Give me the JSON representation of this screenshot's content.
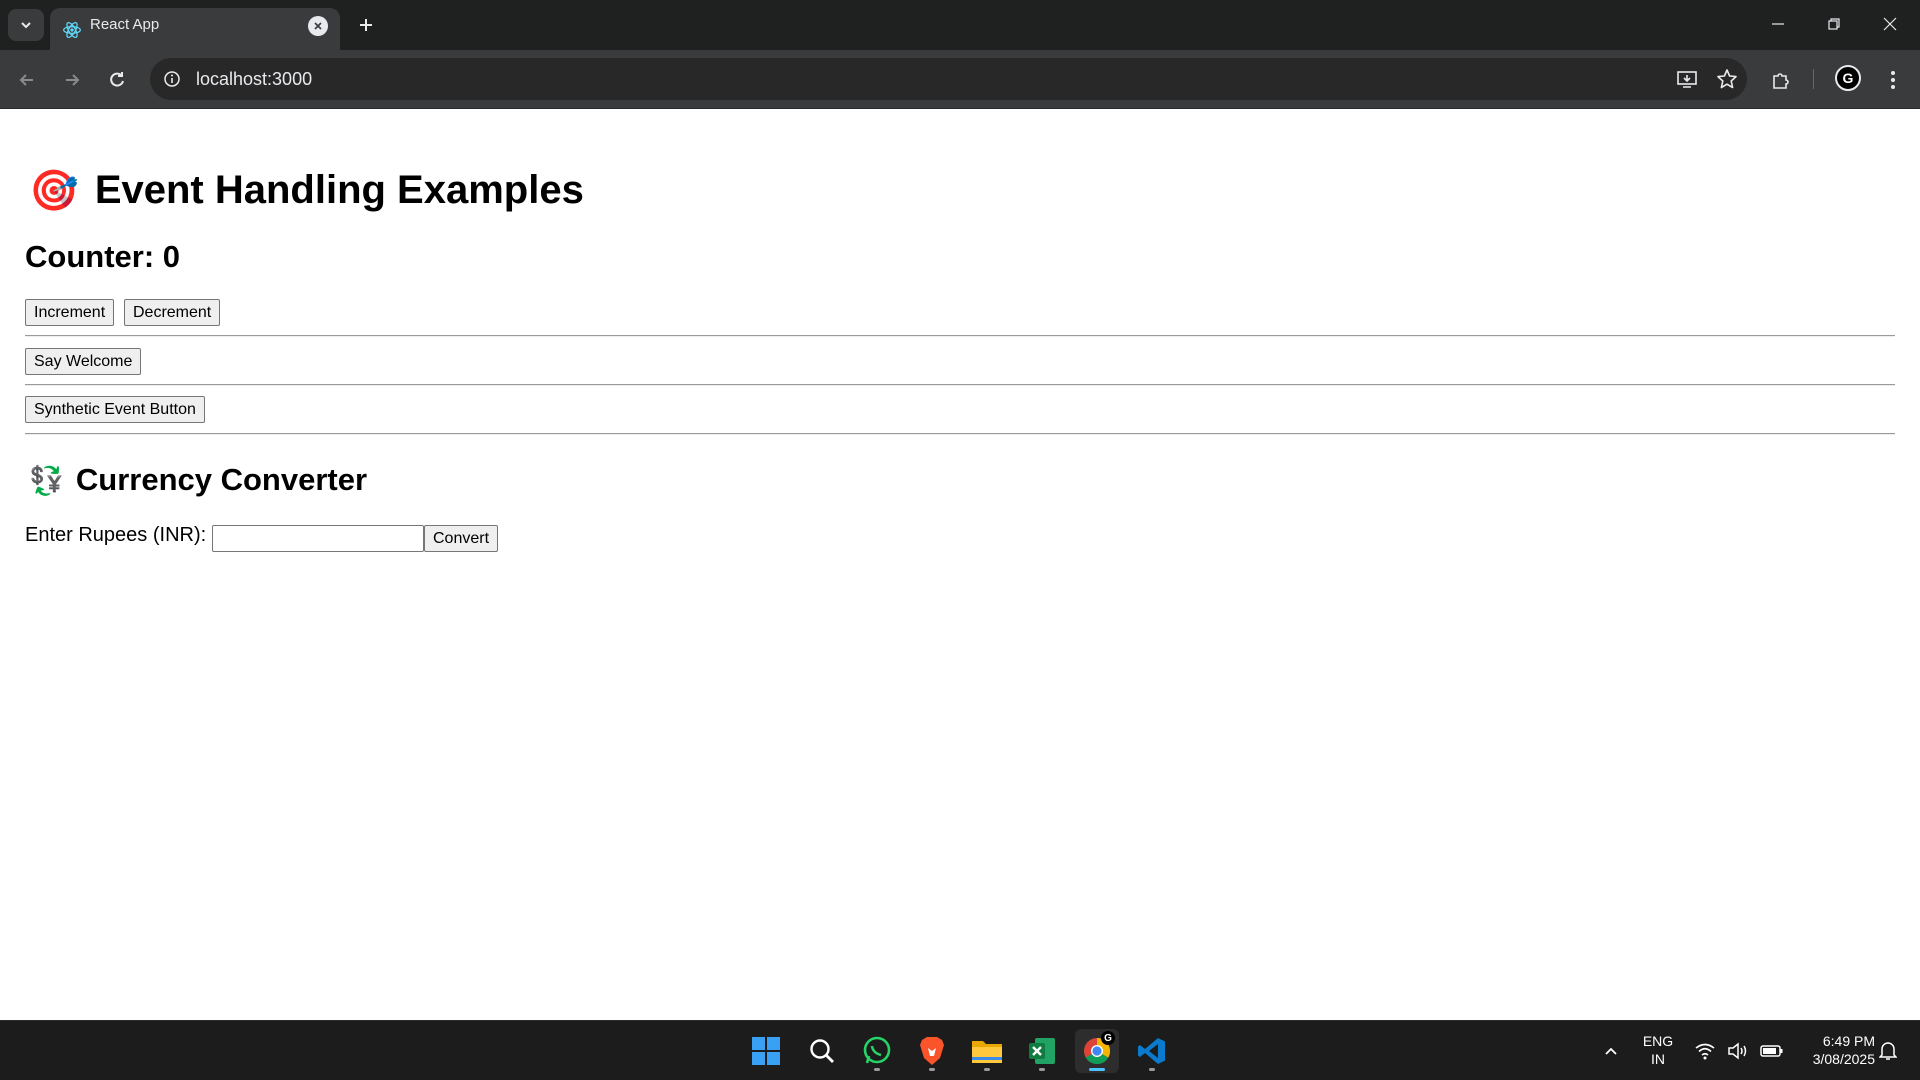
{
  "browser": {
    "tab_title": "React App",
    "url": "localhost:3000",
    "profile_initial": "G"
  },
  "page": {
    "heading": "Event Handling Examples",
    "heading_emoji": "🎯",
    "counter_label": "Counter: 0",
    "increment_label": "Increment",
    "decrement_label": "Decrement",
    "welcome_label": "Say Welcome",
    "synthetic_label": "Synthetic Event Button",
    "converter_title": "Currency Converter",
    "converter_emoji": "💱",
    "input_label": "Enter Rupees (INR):",
    "input_value": "",
    "convert_label": "Convert"
  },
  "taskbar": {
    "apps": [
      "windows-start",
      "search",
      "whatsapp",
      "brave",
      "file-explorer",
      "excel",
      "chrome",
      "vscode"
    ],
    "active_app": "chrome",
    "language_line1": "ENG",
    "language_line2": "IN",
    "time": "6:49 PM",
    "date": "3/08/2025"
  },
  "colors": {
    "chrome_dark": "#1f2020",
    "chrome_toolbar": "#3a3b3c",
    "taskbar": "#1c1c1c",
    "accent_blue": "#4cc2ff"
  }
}
